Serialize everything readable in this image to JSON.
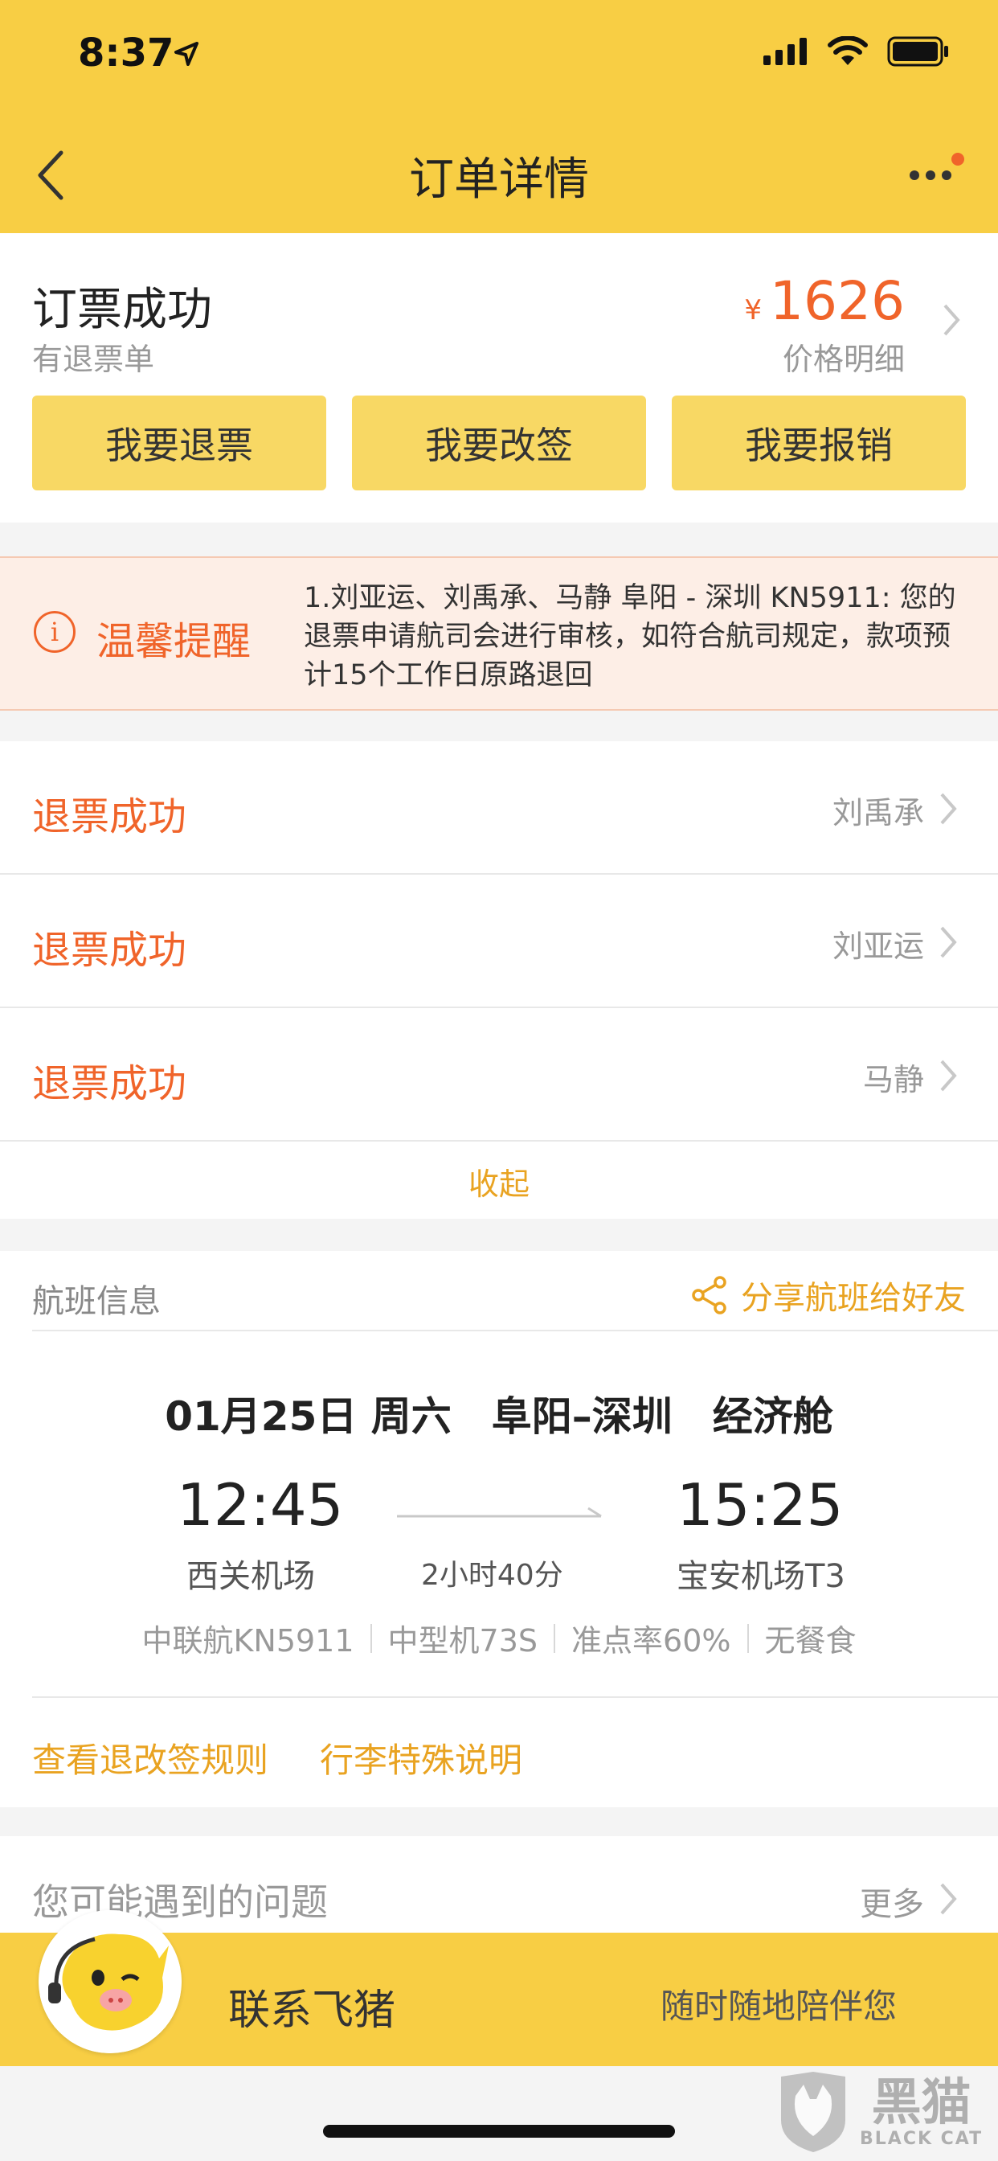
{
  "status_bar": {
    "time": "8:37"
  },
  "nav": {
    "title": "订单详情"
  },
  "order": {
    "status": "订票成功",
    "sub_status": "有退票单",
    "currency": "¥",
    "price": "1626",
    "price_detail": "价格明细",
    "buttons": [
      "我要退票",
      "我要改签",
      "我要报销"
    ]
  },
  "reminder": {
    "icon": "info-icon",
    "title": "温馨提醒",
    "text": "1.刘亚运、刘禹承、马静 阜阳 - 深圳 KN5911: 您的退票申请航司会进行审核，如符合航司规定，款项预计15个工作日原路退回"
  },
  "refunds": [
    {
      "status": "退票成功",
      "name": "刘禹承"
    },
    {
      "status": "退票成功",
      "name": "刘亚运"
    },
    {
      "status": "退票成功",
      "name": "马静"
    }
  ],
  "collapse_label": "收起",
  "flight": {
    "section_title": "航班信息",
    "share_label": "分享航班给好友",
    "date_line": "01月25日 周六　阜阳–深圳　经济舱",
    "dep_time": "12:45",
    "arr_time": "15:25",
    "dep_airport": "西关机场",
    "arr_airport": "宝安机场T3",
    "duration": "2小时40分",
    "meta": [
      "中联航KN5911",
      "中型机73S",
      "准点率60%",
      "无餐食"
    ],
    "links": [
      "查看退改签规则",
      "行李特殊说明"
    ]
  },
  "faq": {
    "title": "您可能遇到的问题",
    "more": "更多"
  },
  "bottom": {
    "contact": "联系飞猪",
    "slogan": "随时随地陪伴您"
  },
  "watermark": {
    "cn": "黑猫",
    "en": "BLACK CAT"
  },
  "colors": {
    "brand_yellow": "#f8ce44",
    "button_yellow": "#f8d864",
    "accent_orange": "#f0642a",
    "link_gold": "#e9a321"
  }
}
